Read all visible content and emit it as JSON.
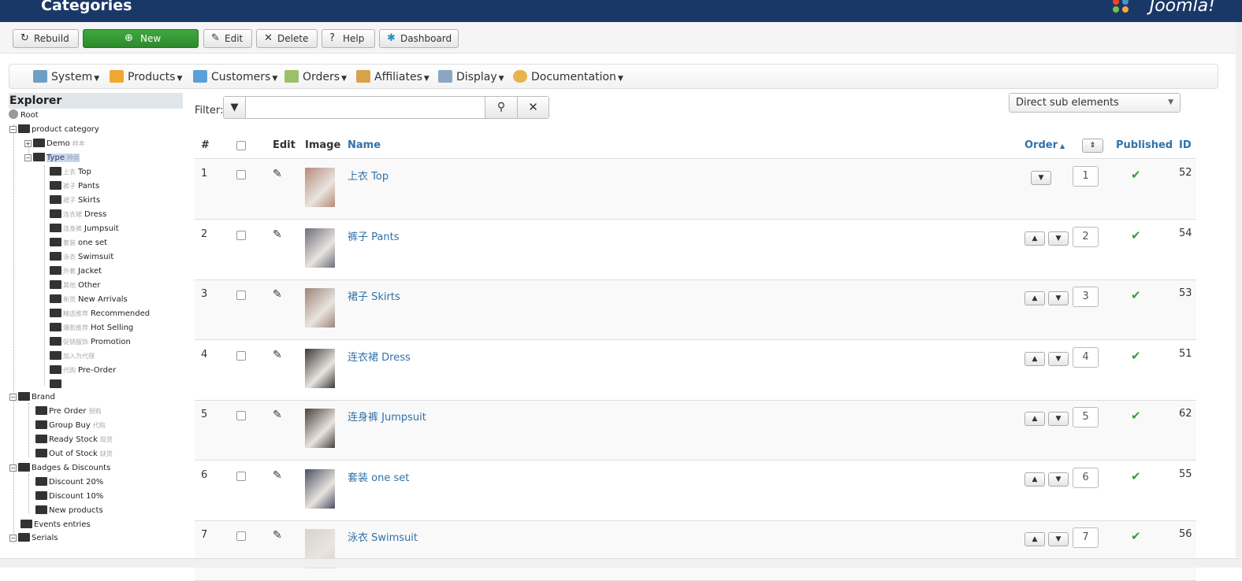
{
  "header": {
    "title": "Categories",
    "logo_text": "Joomla!"
  },
  "toolbar": {
    "rebuild": "Rebuild",
    "new": "New",
    "edit": "Edit",
    "delete": "Delete",
    "help": "Help",
    "dashboard": "Dashboard"
  },
  "menu": {
    "system": "System",
    "products": "Products",
    "customers": "Customers",
    "orders": "Orders",
    "affiliates": "Affiliates",
    "display": "Display",
    "documentation": "Documentation"
  },
  "explorer": {
    "title": "Explorer",
    "root": "Root",
    "product_category": "product category",
    "demo": "Demo",
    "demo_cn": "样本",
    "type": "Type",
    "type_cn": "种类",
    "children": [
      {
        "cn": "上衣",
        "en": "Top"
      },
      {
        "cn": "裤子",
        "en": "Pants"
      },
      {
        "cn": "裙子",
        "en": "Skirts"
      },
      {
        "cn": "连衣裙",
        "en": "Dress"
      },
      {
        "cn": "连身裤",
        "en": "Jumpsuit"
      },
      {
        "cn": "套装",
        "en": "one set"
      },
      {
        "cn": "泳衣",
        "en": "Swimsuit"
      },
      {
        "cn": "外套",
        "en": "Jacket"
      },
      {
        "cn": "其他",
        "en": "Other"
      },
      {
        "cn": "新货",
        "en": "New Arrivals"
      },
      {
        "cn": "精选推荐",
        "en": "Recommended"
      },
      {
        "cn": "爆款推荐",
        "en": "Hot Selling"
      },
      {
        "cn": "促销服饰",
        "en": "Promotion"
      },
      {
        "cn": "加入为代理",
        "en": ""
      },
      {
        "cn": "代购",
        "en": "Pre-Order"
      }
    ],
    "brand": "Brand",
    "brand_children": [
      {
        "en": "Pre Order",
        "cn": "预购"
      },
      {
        "en": "Group Buy",
        "cn": "代购"
      },
      {
        "en": "Ready Stock",
        "cn": "现货"
      },
      {
        "en": "Out of Stock",
        "cn": "缺货"
      }
    ],
    "badges": "Badges & Discounts",
    "badges_children": [
      "Discount 20%",
      "Discount 10%",
      "New products"
    ],
    "events": "Events entries",
    "serials": "Serials"
  },
  "filter": {
    "label": "Filter:",
    "value": "",
    "placeholder": ""
  },
  "select": {
    "value": "Direct sub elements"
  },
  "table": {
    "headers": {
      "num": "#",
      "edit": "Edit",
      "image": "Image",
      "name": "Name",
      "order": "Order",
      "published": "Published",
      "id": "ID"
    },
    "rows": [
      {
        "num": "1",
        "name": "上衣 Top",
        "order": "1",
        "id": "52",
        "color": "#b58b7a"
      },
      {
        "num": "2",
        "name": "裤子 Pants",
        "order": "2",
        "id": "54",
        "color": "#6e6e7a"
      },
      {
        "num": "3",
        "name": "裙子 Skirts",
        "order": "3",
        "id": "53",
        "color": "#9c8577"
      },
      {
        "num": "4",
        "name": "连衣裙 Dress",
        "order": "4",
        "id": "51",
        "color": "#3a3a3a"
      },
      {
        "num": "5",
        "name": "连身裤 Jumpsuit",
        "order": "5",
        "id": "62",
        "color": "#4a3f3c"
      },
      {
        "num": "6",
        "name": "套装 one set",
        "order": "6",
        "id": "55",
        "color": "#4b4f63"
      },
      {
        "num": "7",
        "name": "泳衣 Swimsuit",
        "order": "7",
        "id": "56",
        "color": "#d8d2cc"
      }
    ]
  }
}
